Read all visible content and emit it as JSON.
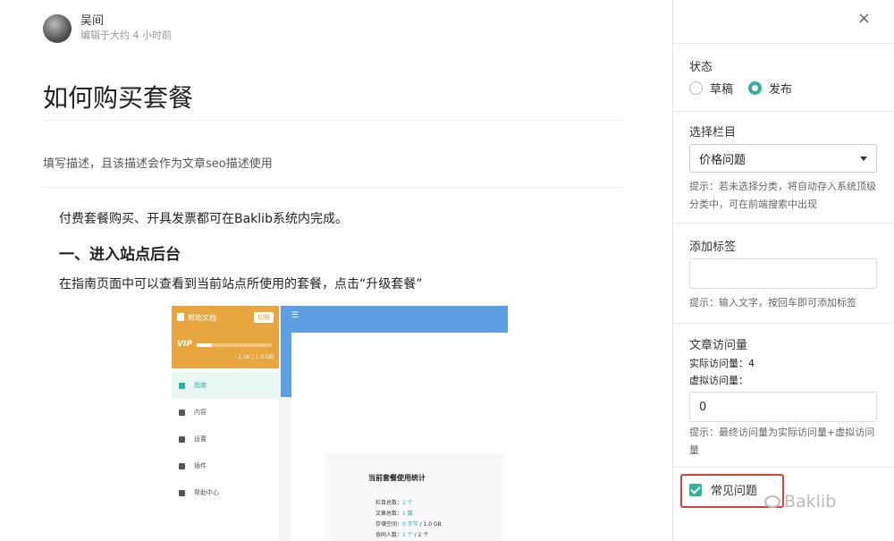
{
  "author": {
    "name": "吴间",
    "meta": "编辑于大约 4 小时前"
  },
  "article": {
    "title": "如何购买套餐",
    "description": "填写描述，且该描述会作为文章seo描述使用",
    "paragraph1": "付费套餐购买、开具发票都可在Baklib系统内完成。",
    "heading1": "一、进入站点后台",
    "paragraph2": "在指南页面中可以查看到当前站点所使用的套餐，点击“升级套餐”"
  },
  "screenshot": {
    "card_title": "帮助文档",
    "card_button": "切换",
    "vip": "VIP",
    "usage_fraction": 0.2,
    "size_text": "1.0K / 1.0 GB",
    "nav": [
      "指南",
      "内容",
      "设置",
      "插件",
      "帮助中心"
    ],
    "menu_icon": "☰",
    "stats_title": "当前套餐使用统计",
    "stats": [
      {
        "label": "栏目总数：",
        "value": "1 个",
        "extra": ""
      },
      {
        "label": "文章总数：",
        "value": "1 篇",
        "extra": ""
      },
      {
        "label": "存储空间：",
        "value": "0 字节",
        "extra": " / 1.0 GB"
      },
      {
        "label": "协同人数：",
        "value": "1 个",
        "extra": " / 2 个"
      }
    ]
  },
  "panel": {
    "close": "×",
    "status_label": "状态",
    "status_options": [
      "草稿",
      "发布"
    ],
    "status_selected": "发布",
    "column_label": "选择栏目",
    "column_value": "价格问题",
    "column_hint": "提示：若未选择分类，将自动存入系统顶级分类中，可在前端搜索中出现",
    "tags_label": "添加标签",
    "tags_value": "",
    "tags_hint": "提示：输入文字，按回车即可添加标签",
    "views_label": "文章访问量",
    "actual_views": "实际访问量：4",
    "virtual_views_label": "虚拟访问量：",
    "virtual_views_value": "0",
    "views_hint": "提示：最终访问量为实际访问量+虚拟访问量",
    "faq_label": "常见问题",
    "faq_checked": true,
    "watermark": "Baklib"
  },
  "colors": {
    "accent": "#2fb39a",
    "highlight": "#d9443a",
    "card": "#e7a63f",
    "topbar": "#5d9fe0"
  }
}
